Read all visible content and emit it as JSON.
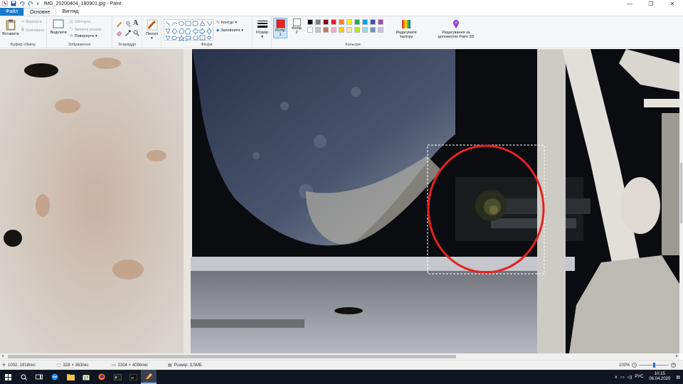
{
  "window": {
    "title": "IMG_20200404_180901.jpg - Paint",
    "quick_access_arrow": "∨",
    "minimize": "—",
    "maximize": "❐",
    "close": "✕"
  },
  "tabs": {
    "file": "Файл",
    "home": "Основне",
    "view": "Вигляд"
  },
  "ribbon": {
    "clipboard": {
      "paste": "Вставити",
      "cut": "Вирізати",
      "copy": "Копіювати",
      "label": "Буфер обміну"
    },
    "image": {
      "select": "Виділити",
      "crop": "Обітнути",
      "resize": "Змінити розмір",
      "rotate": "Повернути",
      "label": "Зображення"
    },
    "tools": {
      "label": "Знаряддя"
    },
    "brushes": {
      "label": "Пензлі"
    },
    "shapes": {
      "outline": "Контур",
      "fill": "Заповнити",
      "label": "Фігури"
    },
    "size": {
      "label": "Розмір"
    },
    "colors": {
      "color1": "Колір 1",
      "color2": "Колір 2",
      "edit_palette": "Редагувати палітру",
      "edit_paint3d": "Редагування за допомогою Paint 3D",
      "label": "Кольори",
      "color1_value": "#e8211f",
      "color2_value": "#ffffff",
      "palette_row1": [
        "#000000",
        "#7f7f7f",
        "#880015",
        "#ed1c24",
        "#ff7f27",
        "#fff200",
        "#22b14c",
        "#00a2e8",
        "#3f48cc",
        "#a349a4"
      ],
      "palette_row2": [
        "#ffffff",
        "#c3c3c3",
        "#b97a57",
        "#ffaec9",
        "#ffc90e",
        "#efe4b0",
        "#b5e61d",
        "#99d9ea",
        "#7092be",
        "#c8bfe7"
      ]
    }
  },
  "status": {
    "cursor_pos": "1002, 1918пкс",
    "selection_size": "328 × 363пкс",
    "image_size": "2304 × 4096пкс",
    "file_size": "Розмір: 3,5МБ",
    "zoom": "100%"
  },
  "taskbar": {
    "language": "РУС",
    "time": "10:15",
    "date": "06.04.2020"
  }
}
